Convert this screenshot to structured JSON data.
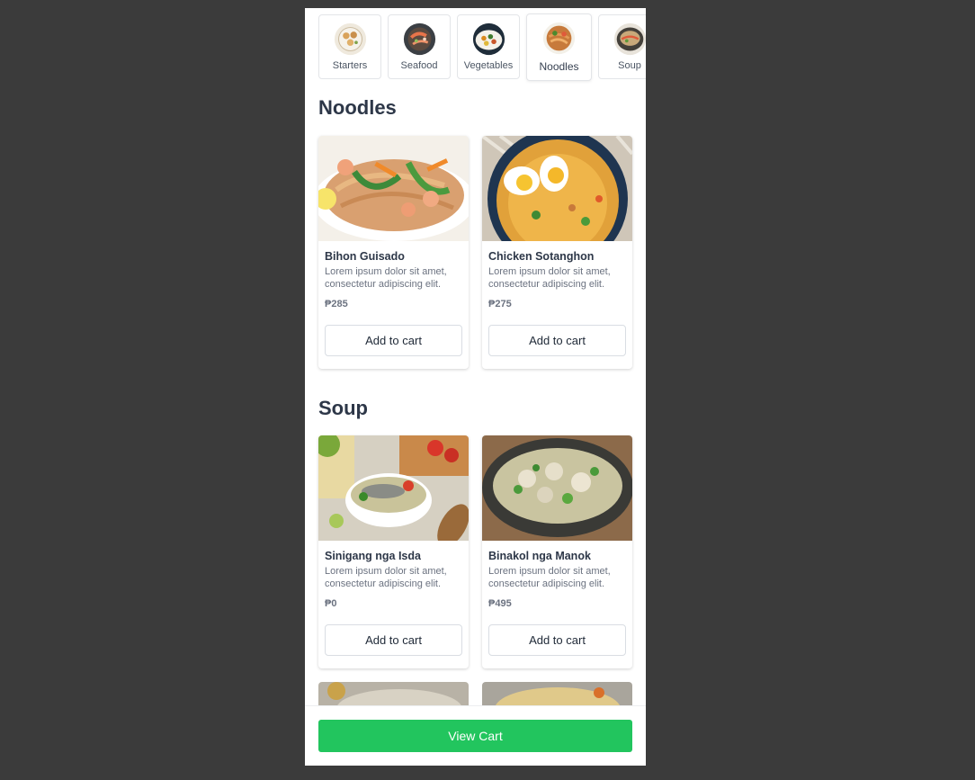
{
  "categories": [
    {
      "label": "Starters",
      "icon": "starters-dish-icon"
    },
    {
      "label": "Seafood",
      "icon": "seafood-dish-icon"
    },
    {
      "label": "Vegetables",
      "icon": "vegetables-dish-icon"
    },
    {
      "label": "Noodles",
      "icon": "noodles-dish-icon",
      "active": true
    },
    {
      "label": "Soup",
      "icon": "soup-dish-icon"
    }
  ],
  "sections": [
    {
      "title": "Noodles",
      "items": [
        {
          "name": "Bihon Guisado",
          "description": "Lorem ipsum dolor sit amet, consectetur adipiscing elit.",
          "price": "₱285",
          "button": "Add to cart"
        },
        {
          "name": "Chicken Sotanghon",
          "description": "Lorem ipsum dolor sit amet, consectetur adipiscing elit.",
          "price": "₱275",
          "button": "Add to cart"
        }
      ]
    },
    {
      "title": "Soup",
      "items": [
        {
          "name": "Sinigang nga Isda",
          "description": "Lorem ipsum dolor sit amet, consectetur adipiscing elit.",
          "price": "₱0",
          "button": "Add to cart"
        },
        {
          "name": "Binakol nga Manok",
          "description": "Lorem ipsum dolor sit amet, consectetur adipiscing elit.",
          "price": "₱495",
          "button": "Add to cart"
        }
      ]
    }
  ],
  "footer": {
    "view_cart_label": "View Cart"
  },
  "colors": {
    "accent": "#22c55e",
    "background": "#3b3b3b",
    "heading": "#2d3748"
  }
}
